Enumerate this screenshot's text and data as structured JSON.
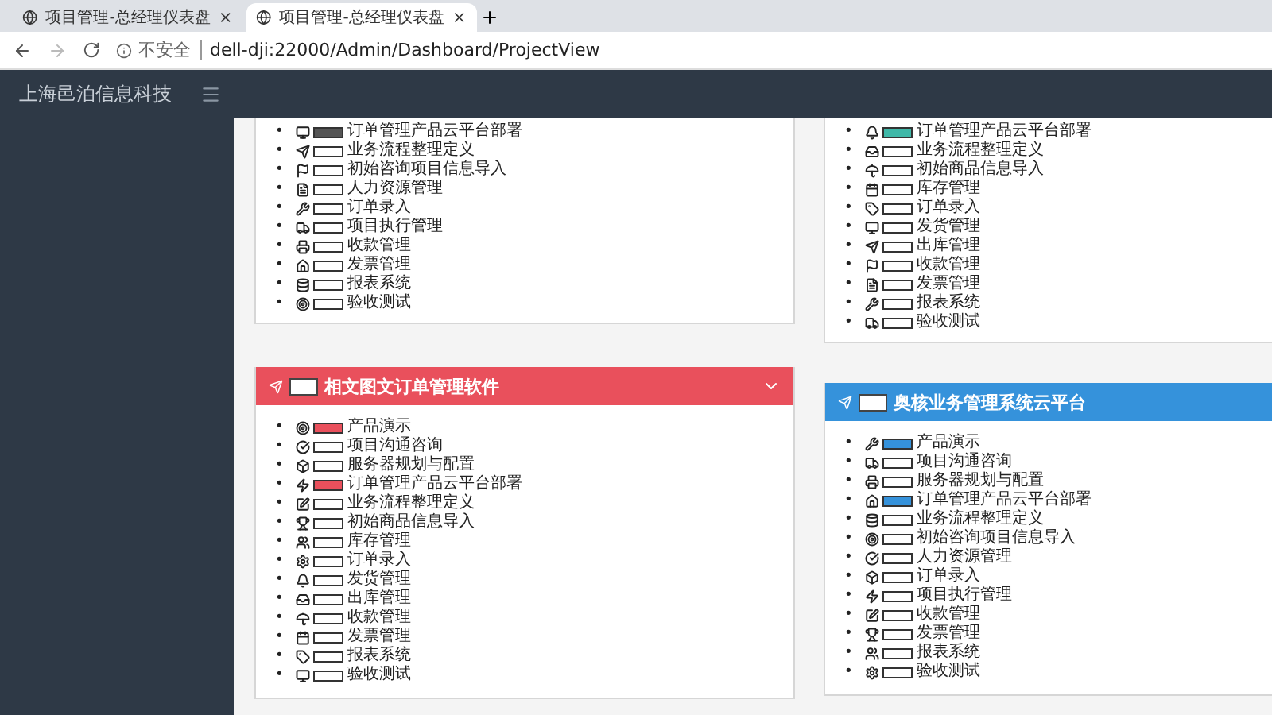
{
  "browser": {
    "tabs": [
      {
        "title": "项目管理-总经理仪表盘",
        "selected": false
      },
      {
        "title": "项目管理-总经理仪表盘",
        "selected": true
      }
    ],
    "security": "不安全",
    "url": "dell-dji:22000/Admin/Dashboard/ProjectView"
  },
  "header": {
    "brand": "上海邑泊信息科技"
  },
  "columns": [
    {
      "cards": [
        {
          "color": "#555555",
          "items": [
            {
              "bullet": "•",
              "label": "订单管理产品云平台部署",
              "highlighted": true
            },
            {
              "bullet": "•",
              "label": "业务流程整理定义",
              "highlighted": false
            },
            {
              "bullet": "•",
              "label": "初始咨询项目信息导入",
              "highlighted": false
            },
            {
              "bullet": "•",
              "label": "人力资源管理",
              "highlighted": false
            },
            {
              "bullet": "•",
              "label": "订单录入",
              "highlighted": false
            },
            {
              "bullet": "•",
              "label": "项目执行管理",
              "highlighted": false
            },
            {
              "bullet": "•",
              "label": "收款管理",
              "highlighted": false
            },
            {
              "bullet": "•",
              "label": "发票管理",
              "highlighted": false
            },
            {
              "bullet": "•",
              "label": "报表系统",
              "highlighted": false
            },
            {
              "bullet": "•",
              "label": "验收测试",
              "highlighted": false
            }
          ]
        },
        {
          "title": "相文图文订单管理软件",
          "color": "#e9505c",
          "collapsible": true,
          "items": [
            {
              "bullet": "•",
              "label": "产品演示",
              "highlighted": true
            },
            {
              "bullet": "•",
              "label": "项目沟通咨询",
              "highlighted": false
            },
            {
              "bullet": "•",
              "label": "服务器规划与配置",
              "highlighted": false
            },
            {
              "bullet": "•",
              "label": "订单管理产品云平台部署",
              "highlighted": true
            },
            {
              "bullet": "•",
              "label": "业务流程整理定义",
              "highlighted": false
            },
            {
              "bullet": "•",
              "label": "初始商品信息导入",
              "highlighted": false
            },
            {
              "bullet": "•",
              "label": "库存管理",
              "highlighted": false
            },
            {
              "bullet": "•",
              "label": "订单录入",
              "highlighted": false
            },
            {
              "bullet": "•",
              "label": "发货管理",
              "highlighted": false
            },
            {
              "bullet": "•",
              "label": "出库管理",
              "highlighted": false
            },
            {
              "bullet": "•",
              "label": "收款管理",
              "highlighted": false
            },
            {
              "bullet": "•",
              "label": "发票管理",
              "highlighted": false
            },
            {
              "bullet": "•",
              "label": "报表系统",
              "highlighted": false
            },
            {
              "bullet": "•",
              "label": "验收测试",
              "highlighted": false
            }
          ]
        }
      ]
    },
    {
      "cards": [
        {
          "color": "#3fb8a8",
          "items": [
            {
              "bullet": "•",
              "label": "订单管理产品云平台部署",
              "highlighted": true
            },
            {
              "bullet": "•",
              "label": "业务流程整理定义",
              "highlighted": false
            },
            {
              "bullet": "•",
              "label": "初始商品信息导入",
              "highlighted": false
            },
            {
              "bullet": "•",
              "label": "库存管理",
              "highlighted": false
            },
            {
              "bullet": "•",
              "label": "订单录入",
              "highlighted": false
            },
            {
              "bullet": "•",
              "label": "发货管理",
              "highlighted": false
            },
            {
              "bullet": "•",
              "label": "出库管理",
              "highlighted": false
            },
            {
              "bullet": "•",
              "label": "收款管理",
              "highlighted": false
            },
            {
              "bullet": "•",
              "label": "发票管理",
              "highlighted": false
            },
            {
              "bullet": "•",
              "label": "报表系统",
              "highlighted": false
            },
            {
              "bullet": "•",
              "label": "验收测试",
              "highlighted": false
            }
          ]
        },
        {
          "title": "奥核业务管理系统云平台",
          "color": "#3592db",
          "collapsible": false,
          "items": [
            {
              "bullet": "•",
              "label": "产品演示",
              "highlighted": true
            },
            {
              "bullet": "•",
              "label": "项目沟通咨询",
              "highlighted": false
            },
            {
              "bullet": "•",
              "label": "服务器规划与配置",
              "highlighted": false
            },
            {
              "bullet": "•",
              "label": "订单管理产品云平台部署",
              "highlighted": true
            },
            {
              "bullet": "•",
              "label": "业务流程整理定义",
              "highlighted": false
            },
            {
              "bullet": "•",
              "label": "初始咨询项目信息导入",
              "highlighted": false
            },
            {
              "bullet": "•",
              "label": "人力资源管理",
              "highlighted": false
            },
            {
              "bullet": "•",
              "label": "订单录入",
              "highlighted": false
            },
            {
              "bullet": "•",
              "label": "项目执行管理",
              "highlighted": false
            },
            {
              "bullet": "•",
              "label": "收款管理",
              "highlighted": false
            },
            {
              "bullet": "•",
              "label": "发票管理",
              "highlighted": false
            },
            {
              "bullet": "•",
              "label": "报表系统",
              "highlighted": false
            },
            {
              "bullet": "•",
              "label": "验收测试",
              "highlighted": false
            }
          ]
        }
      ]
    }
  ]
}
